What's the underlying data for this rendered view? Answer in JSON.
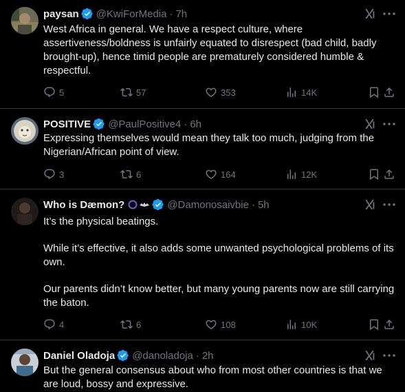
{
  "colors": {
    "background": "#000000",
    "text": "#e7e9ea",
    "muted": "#71767b",
    "divider": "#2f3336",
    "verified": "#1d9bf0"
  },
  "tweets": [
    {
      "name": "paysan",
      "handle": "@KwiForMedia",
      "time": "7h",
      "text": "West Africa in general. We have a respect culture, where assertiveness/boldness is unfairly equated to disrespect (bad child, badly brought-up), hence timid people are prematurely considered humble & respectful.",
      "replies": "5",
      "reposts": "57",
      "likes": "353",
      "views": "14K"
    },
    {
      "name": "POSITIVE",
      "handle": "@PaulPositive4",
      "time": "6h",
      "text": "Expressing themselves would mean they talk too much, judging from the Nigerian/African point of view.",
      "replies": "3",
      "reposts": "6",
      "likes": "164",
      "views": "12K"
    },
    {
      "name": "Who is Dæmon?",
      "handle": "@Damonosaivbie",
      "time": "5h",
      "text": "It’s the physical beatings.\n\nWhile it’s effective, it also adds some unwanted psychological problems of its own.\n\nOur parents didn’t know better, but many young parents now are still carrying the baton.",
      "replies": "4",
      "reposts": "6",
      "likes": "108",
      "views": "10K"
    },
    {
      "name": "Daniel Oladoja",
      "handle": "@danoladoja",
      "time": "2h",
      "text": "But the general consensus about who from most other countries is that we are loud, bossy and expressive."
    }
  ]
}
